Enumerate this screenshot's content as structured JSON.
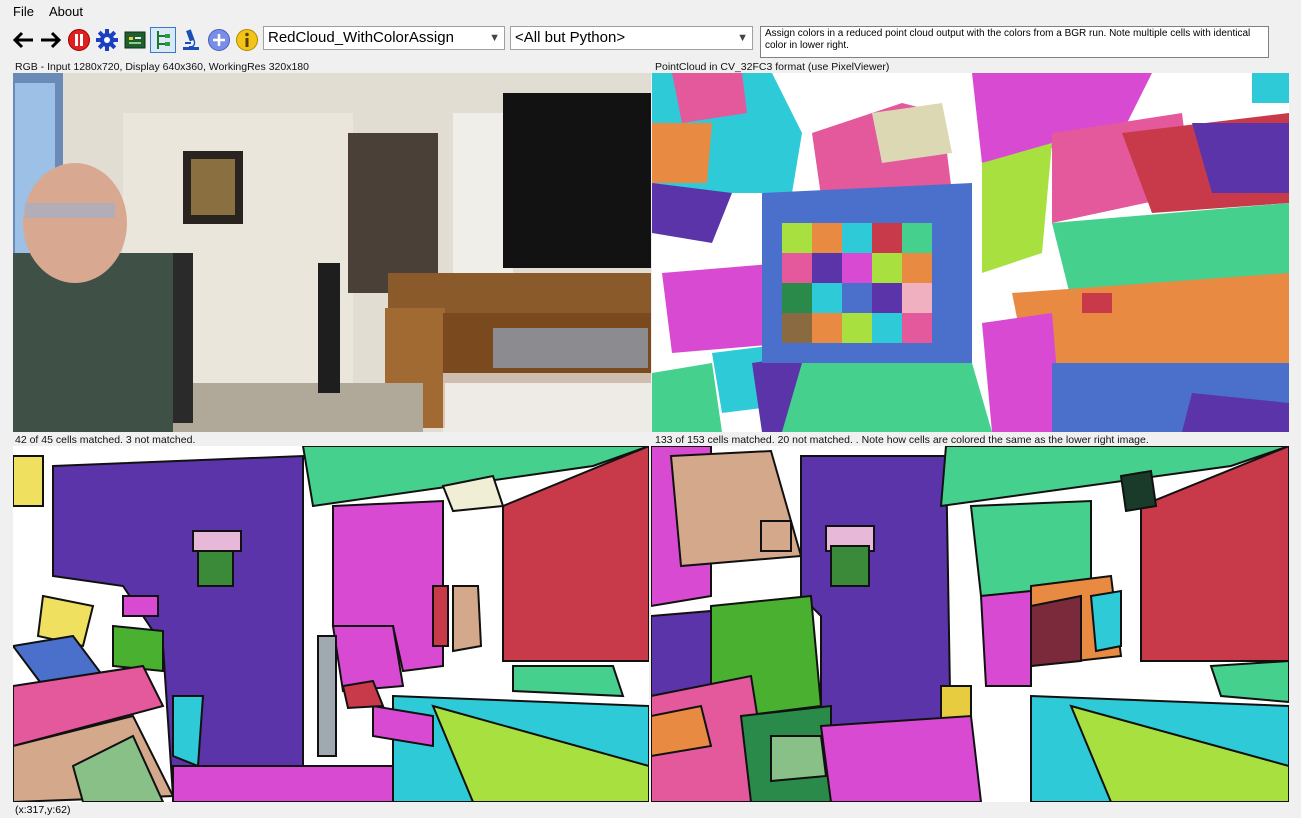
{
  "menu": {
    "file": "File",
    "about": "About"
  },
  "toolbar": {
    "algorithm_selected": "RedCloud_WithColorAssign",
    "filter_selected": "<All but Python>",
    "description": "Assign colors in a reduced point cloud output with the colors from a BGR run.  Note multiple cells with identical color in lower right.",
    "icons": [
      "back-arrow-icon",
      "forward-arrow-icon",
      "pause-icon",
      "gear-icon",
      "chip-icon",
      "tree-view-icon",
      "microscope-icon",
      "plus-icon",
      "info-icon"
    ]
  },
  "panels": {
    "top_left_label": "RGB - Input 1280x720, Display 640x360, WorkingRes 320x180",
    "top_right_label": "PointCloud in CV_32FC3 format (use PixelViewer)",
    "bottom_left_label": "42 of 45 cells matched. 3 not matched.",
    "bottom_right_label": "133 of 153 cells matched. 20 not matched. .  Note how cells are colored the same as the lower right image."
  },
  "status": {
    "coords": "(x:317,y:62)"
  },
  "colors": {
    "purple": "#5a34a8",
    "red": "#c83a4a",
    "green_teal": "#46d08e",
    "magenta": "#d84ad2",
    "orange": "#e88a42",
    "blue": "#4a70cc",
    "lime": "#a8e040",
    "cyan": "#2ecad8",
    "pink": "#e4589c",
    "tan": "#d4a88a"
  }
}
